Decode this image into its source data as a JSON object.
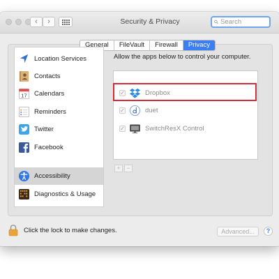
{
  "window": {
    "title": "Security & Privacy",
    "nav_back": "‹",
    "nav_forward": "›"
  },
  "search": {
    "placeholder": "Search",
    "value": ""
  },
  "tabs": [
    {
      "label": "General",
      "active": false
    },
    {
      "label": "FileVault",
      "active": false
    },
    {
      "label": "Firewall",
      "active": false
    },
    {
      "label": "Privacy",
      "active": true
    }
  ],
  "sidebar": {
    "items": [
      {
        "label": "Location Services",
        "icon": "location-arrow-icon"
      },
      {
        "label": "Contacts",
        "icon": "contacts-book-icon"
      },
      {
        "label": "Calendars",
        "icon": "calendar-icon",
        "icon_text": "17"
      },
      {
        "label": "Reminders",
        "icon": "reminders-list-icon"
      },
      {
        "label": "Twitter",
        "icon": "twitter-bird-icon"
      },
      {
        "label": "Facebook",
        "icon": "facebook-f-icon"
      },
      {
        "label": "Accessibility",
        "icon": "accessibility-person-icon",
        "selected": true
      },
      {
        "label": "Diagnostics & Usage",
        "icon": "diagnostics-grid-icon"
      }
    ]
  },
  "main": {
    "heading": "Allow the apps below to control your computer.",
    "apps": [
      {
        "name": "Dropbox",
        "checked": true,
        "icon": "dropbox-icon",
        "highlighted": true
      },
      {
        "name": "duet",
        "checked": true,
        "icon": "duet-icon"
      },
      {
        "name": "SwitchResX Control",
        "checked": true,
        "icon": "switchresx-monitor-icon"
      }
    ],
    "add_label": "+",
    "remove_label": "−",
    "check_mark": "✓"
  },
  "footer": {
    "lock_text": "Click the lock to make changes.",
    "advanced_label": "Advanced...",
    "help_label": "?"
  },
  "colors": {
    "accent": "#3a7ff6",
    "highlight_outline": "#d42b3a",
    "search_focus": "#6fa6ea"
  }
}
